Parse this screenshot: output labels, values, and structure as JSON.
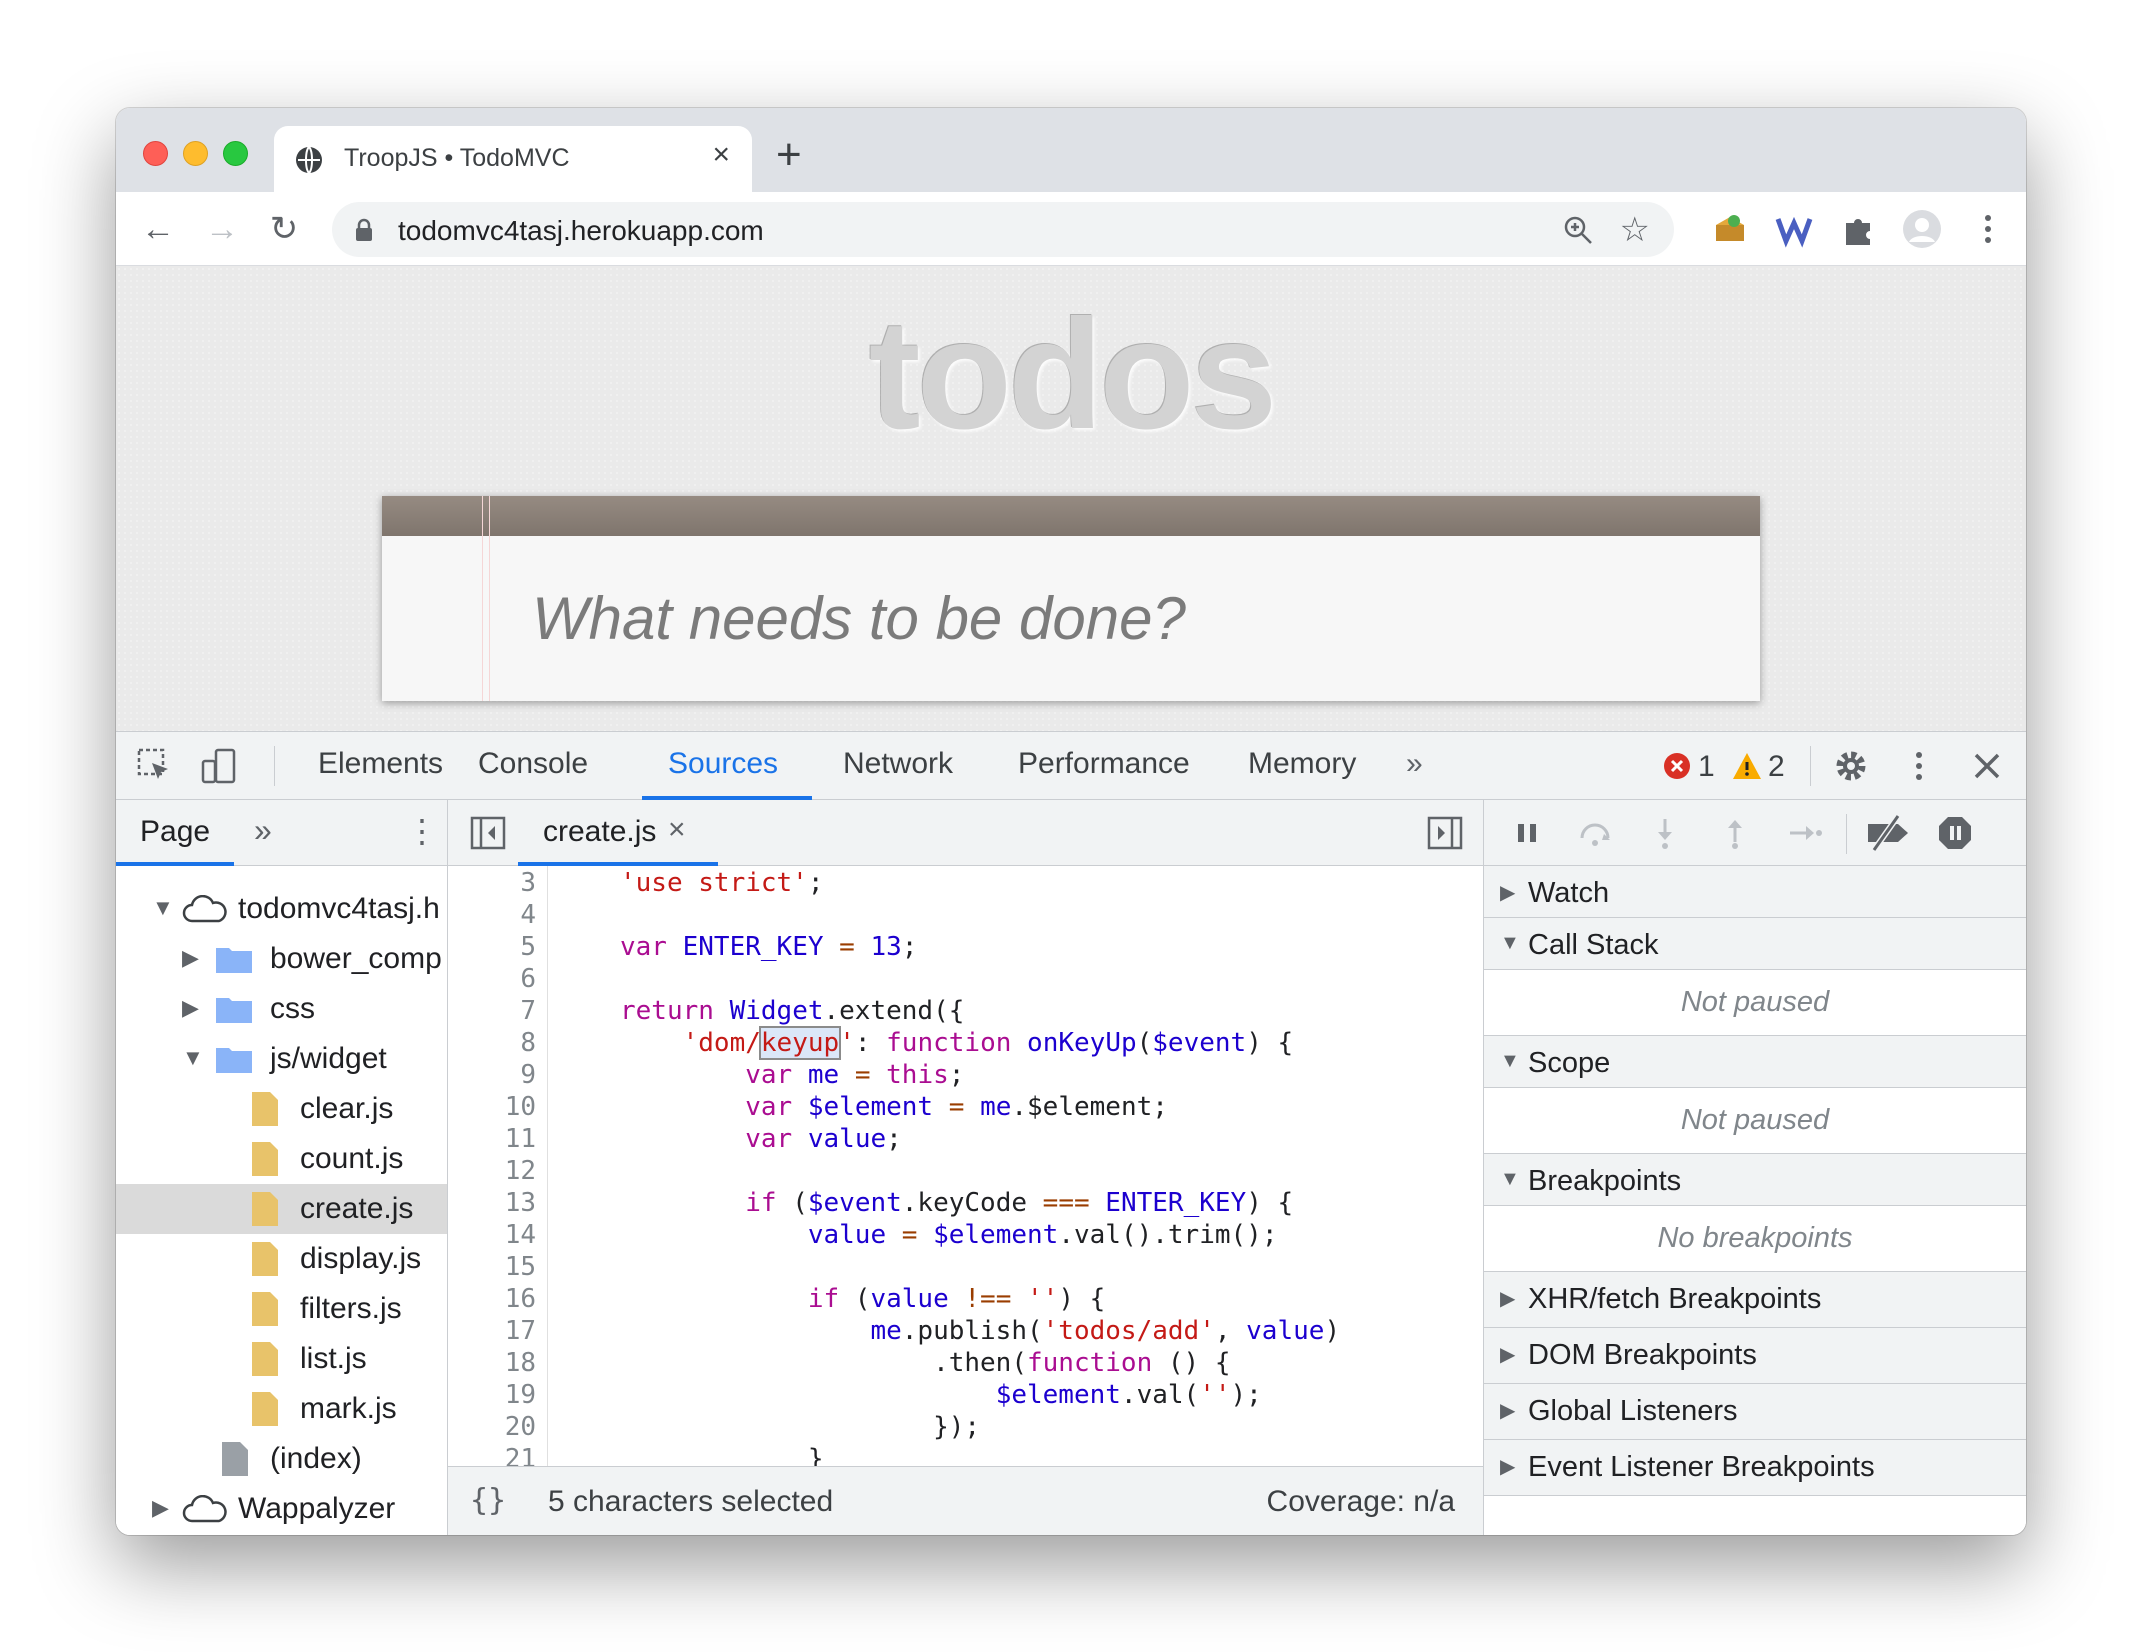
{
  "browser": {
    "tab_title": "TroopJS • TodoMVC",
    "tab_close": "×",
    "new_tab": "+",
    "url": "todomvc4tasj.herokuapp.com",
    "nav": {
      "back": "←",
      "forward": "→",
      "reload": "↻"
    },
    "star": "☆"
  },
  "page": {
    "heading": "todos",
    "input_placeholder": "What needs to be done?"
  },
  "devtools": {
    "tabs": [
      "Elements",
      "Console",
      "Sources",
      "Network",
      "Performance",
      "Memory"
    ],
    "active_tab": "Sources",
    "more_tabs": "»",
    "error_count": "1",
    "warning_count": "2",
    "navigator": {
      "tab": "Page",
      "more": "»",
      "kebab": "⋮",
      "tree": [
        {
          "label": "todomvc4tasj.h",
          "icon": "cloud-icon",
          "expanded": true
        },
        {
          "label": "bower_comp",
          "icon": "folder-icon",
          "expanded": false
        },
        {
          "label": "css",
          "icon": "folder-icon",
          "expanded": false
        },
        {
          "label": "js/widget",
          "icon": "folder-icon",
          "expanded": true
        },
        {
          "label": "clear.js",
          "icon": "file-icon"
        },
        {
          "label": "count.js",
          "icon": "file-icon"
        },
        {
          "label": "create.js",
          "icon": "file-icon",
          "selected": true
        },
        {
          "label": "display.js",
          "icon": "file-icon"
        },
        {
          "label": "filters.js",
          "icon": "file-icon"
        },
        {
          "label": "list.js",
          "icon": "file-icon"
        },
        {
          "label": "mark.js",
          "icon": "file-icon"
        },
        {
          "label": "(index)",
          "icon": "document-icon"
        },
        {
          "label": "Wappalyzer",
          "icon": "cloud-icon",
          "expanded": false
        }
      ]
    },
    "editor": {
      "file_tab": "create.js",
      "tab_close": "×",
      "line_numbers": [
        "3",
        "4",
        "5",
        "6",
        "7",
        "8",
        "9",
        "10",
        "11",
        "12",
        "13",
        "14",
        "15",
        "16",
        "17",
        "18",
        "19",
        "20",
        "21"
      ],
      "status_braces": "{}",
      "selection_info": "5 characters selected",
      "coverage": "Coverage: n/a"
    },
    "debugger": {
      "panes": [
        {
          "label": "Watch",
          "expanded": false
        },
        {
          "label": "Call Stack",
          "expanded": true,
          "message": "Not paused"
        },
        {
          "label": "Scope",
          "expanded": true,
          "message": "Not paused"
        },
        {
          "label": "Breakpoints",
          "expanded": true,
          "message": "No breakpoints"
        },
        {
          "label": "XHR/fetch Breakpoints",
          "expanded": false
        },
        {
          "label": "DOM Breakpoints",
          "expanded": false
        },
        {
          "label": "Global Listeners",
          "expanded": false
        },
        {
          "label": "Event Listener Breakpoints",
          "expanded": false
        }
      ]
    }
  },
  "colors": {
    "accent": "#1a73e8",
    "error": "#d93025",
    "warning": "#f9ab00",
    "folder": "#8ab4f8",
    "file": "#e8c36a"
  }
}
